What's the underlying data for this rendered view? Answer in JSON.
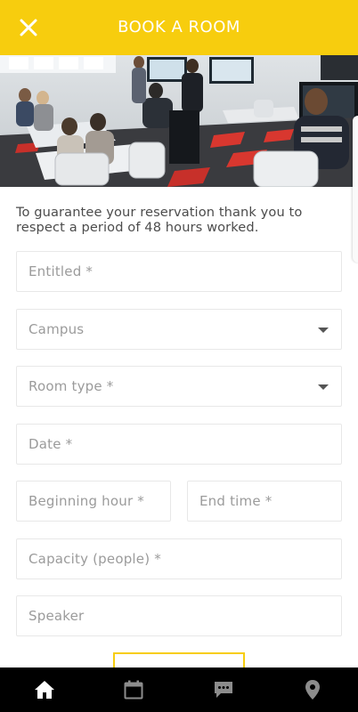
{
  "header": {
    "title": "BOOK A ROOM",
    "background": "#f7cd0e",
    "close_icon": "close-icon"
  },
  "hero_image": {
    "subject": "classroom-photo"
  },
  "notice": "To guarantee your reservation thank you to respect a period of 48 hours worked.",
  "form": {
    "entitled_placeholder": "Entitled *",
    "campus_placeholder": "Campus",
    "room_type_placeholder": "Room type *",
    "date_placeholder": "Date *",
    "beginning_hour_placeholder": "Beginning hour *",
    "end_time_placeholder": "End time *",
    "capacity_placeholder": "Capacity (people) *",
    "speaker_placeholder": "Speaker",
    "dropdown_icon": "chevron-down-icon"
  },
  "tabbar": {
    "items": [
      "home-icon",
      "calendar-icon",
      "chat-icon",
      "location-pin-icon"
    ],
    "active": "home-icon"
  }
}
